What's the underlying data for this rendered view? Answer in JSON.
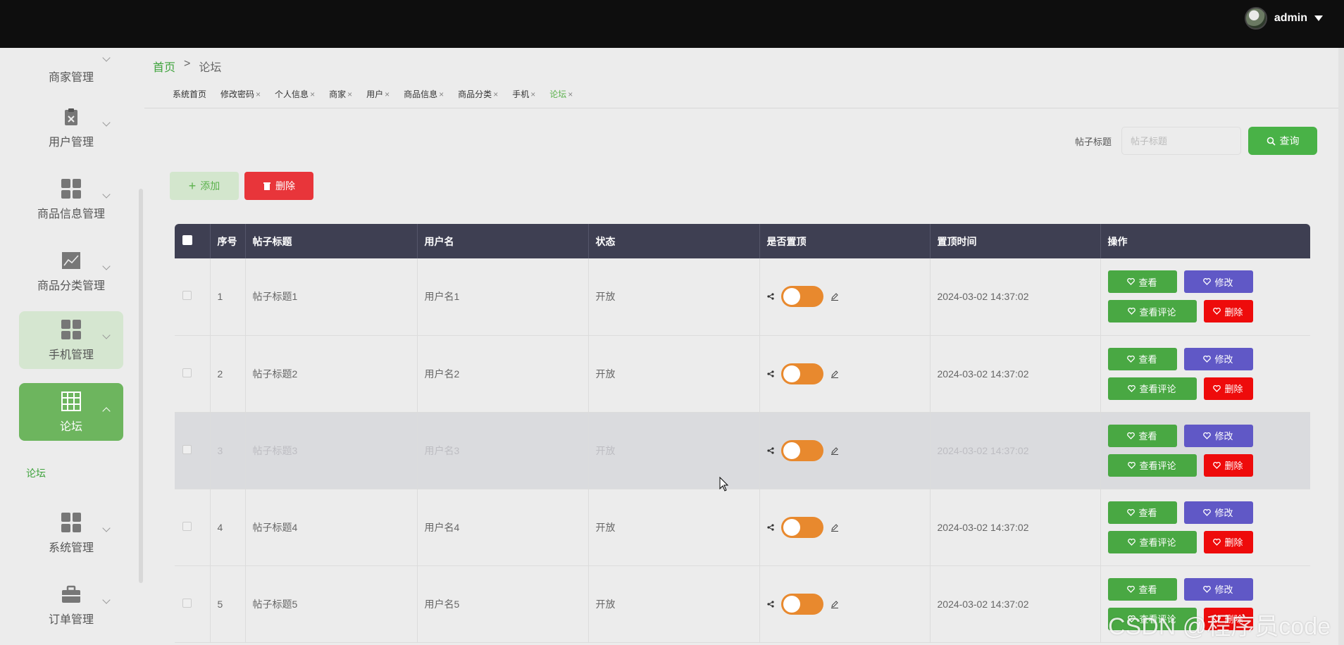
{
  "header": {
    "user_name": "admin"
  },
  "sidebar": {
    "items": [
      {
        "label": "商家管理"
      },
      {
        "label": "用户管理"
      },
      {
        "label": "商品信息管理"
      },
      {
        "label": "商品分类管理"
      },
      {
        "label": "手机管理"
      },
      {
        "label": "论坛"
      },
      {
        "label": "系统管理"
      },
      {
        "label": "订单管理"
      }
    ],
    "sub_item": "论坛"
  },
  "breadcrumb": {
    "home": "首页",
    "separator": ">",
    "current": "论坛"
  },
  "tabs": [
    {
      "label": "系统首页",
      "closable": false
    },
    {
      "label": "修改密码",
      "closable": true
    },
    {
      "label": "个人信息",
      "closable": true
    },
    {
      "label": "商家",
      "closable": true
    },
    {
      "label": "用户",
      "closable": true
    },
    {
      "label": "商品信息",
      "closable": true
    },
    {
      "label": "商品分类",
      "closable": true
    },
    {
      "label": "手机",
      "closable": true
    },
    {
      "label": "论坛",
      "closable": true,
      "active": true
    }
  ],
  "tab_close_glyph": "×",
  "search": {
    "label": "帖子标题",
    "placeholder": "帖子标题",
    "button": "查询"
  },
  "actions": {
    "add": "添加",
    "delete": "删除"
  },
  "table": {
    "columns": [
      "序号",
      "帖子标题",
      "用户名",
      "状态",
      "是否置顶",
      "置顶时间",
      "操作"
    ],
    "rows": [
      {
        "no": "1",
        "title": "帖子标题1",
        "user": "用户名1",
        "status": "开放",
        "time": "2024-03-02 14:37:02"
      },
      {
        "no": "2",
        "title": "帖子标题2",
        "user": "用户名2",
        "status": "开放",
        "time": "2024-03-02 14:37:02"
      },
      {
        "no": "3",
        "title": "帖子标题3",
        "user": "用户名3",
        "status": "开放",
        "time": "2024-03-02 14:37:02"
      },
      {
        "no": "4",
        "title": "帖子标题4",
        "user": "用户名4",
        "status": "开放",
        "time": "2024-03-02 14:37:02"
      },
      {
        "no": "5",
        "title": "帖子标题5",
        "user": "用户名5",
        "status": "开放",
        "time": "2024-03-02 14:37:02"
      }
    ],
    "row_buttons": {
      "view": "查看",
      "edit": "修改",
      "view_comments": "查看评论",
      "delete": "删除"
    }
  },
  "watermark": "CSDN @程序员code",
  "colors": {
    "accent": "#49b247",
    "danger": "#ee0b0b",
    "edit": "#6058c6",
    "toggle": "#e8892e",
    "header": "#3e3f52"
  }
}
